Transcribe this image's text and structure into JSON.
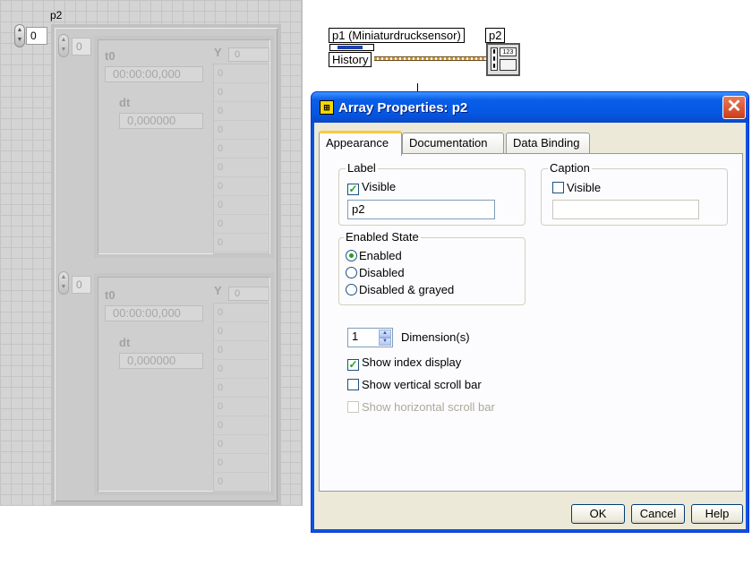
{
  "front_panel": {
    "array_label": "p2",
    "outer_index": "0",
    "inner_index_top": "0",
    "inner_index_bottom": "0",
    "waveform": {
      "t0_label": "t0",
      "t0_value": "00:00:00,000",
      "dt_label": "dt",
      "dt_value": "0,000000",
      "y_label": "Y",
      "y_index": "0",
      "y_values": [
        "0",
        "0",
        "0",
        "0",
        "0",
        "0",
        "0",
        "0",
        "0",
        "0"
      ]
    }
  },
  "block_diagram": {
    "source_label": "p1 (Miniaturdrucksensor)",
    "property_label": "History",
    "sink_label": "p2",
    "sink_glyph": "123"
  },
  "dialog": {
    "title": "Array Properties: p2",
    "icon_glyph": "⊞",
    "tabs": [
      "Appearance",
      "Documentation",
      "Data Binding"
    ],
    "active_tab": "Appearance",
    "label_group": {
      "title": "Label",
      "visible_label": "Visible",
      "visible_checked": true,
      "text_value": "p2"
    },
    "caption_group": {
      "title": "Caption",
      "visible_label": "Visible",
      "visible_checked": false,
      "text_value": ""
    },
    "enabled_group": {
      "title": "Enabled State",
      "options": [
        "Enabled",
        "Disabled",
        "Disabled & grayed"
      ],
      "selected": "Enabled"
    },
    "dimensions": {
      "value": "1",
      "label": "Dimension(s)"
    },
    "show_index_display": {
      "label": "Show index display",
      "checked": true
    },
    "show_vertical_scroll": {
      "label": "Show vertical scroll bar",
      "checked": false
    },
    "show_horizontal_scroll": {
      "label": "Show horizontal scroll bar",
      "checked": false,
      "disabled": true
    },
    "buttons": {
      "ok": "OK",
      "cancel": "Cancel",
      "help": "Help"
    }
  },
  "colors": {
    "titlebar": "#0457e2",
    "dialog_bg": "#ece9d8",
    "check_green": "#21a121",
    "panel_grid": "#d4d4d4"
  }
}
